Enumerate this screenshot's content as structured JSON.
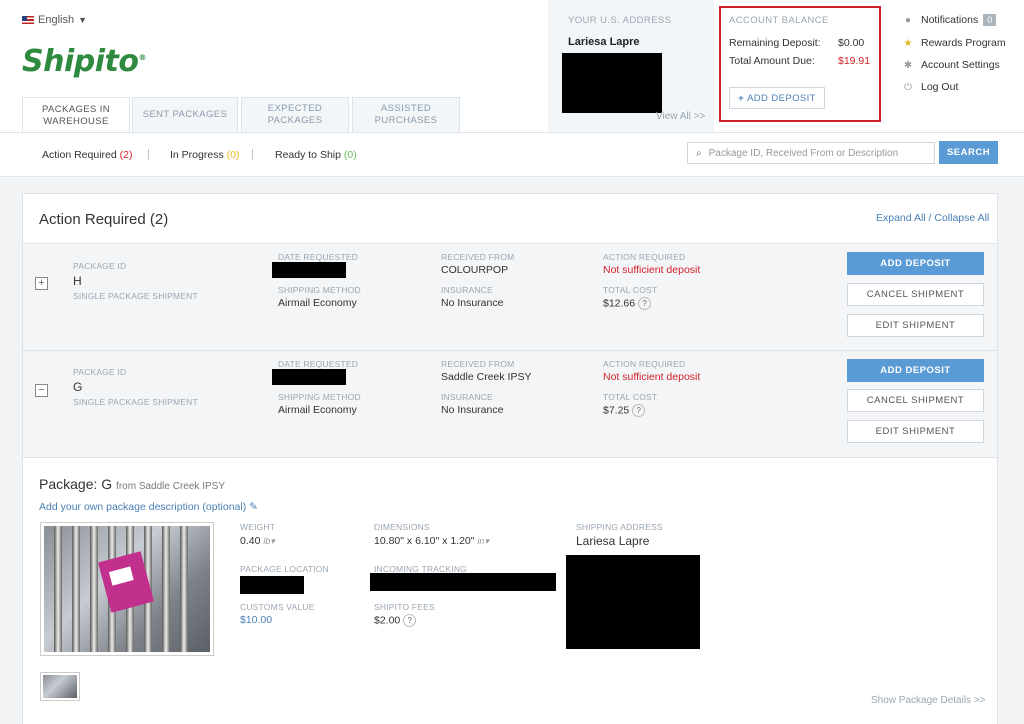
{
  "header": {
    "language": "English",
    "logo_text": "Shipito",
    "logo_mark": "®",
    "tabs": [
      {
        "label_line1": "PACKAGES IN",
        "label_line2": "WAREHOUSE"
      },
      {
        "label_line1": "SENT PACKAGES",
        "label_line2": ""
      },
      {
        "label_line1": "EXPECTED",
        "label_line2": "PACKAGES"
      },
      {
        "label_line1": "ASSISTED",
        "label_line2": "PURCHASES"
      }
    ],
    "address": {
      "title": "YOUR U.S. ADDRESS",
      "name": "Lariesa Lapre",
      "view_all": "View All >>"
    },
    "balance": {
      "title": "ACCOUNT BALANCE",
      "remaining_label": "Remaining Deposit:",
      "remaining_value": "$0.00",
      "due_label": "Total Amount Due:",
      "due_value": "$19.91",
      "button": "ADD DEPOSIT"
    },
    "menu": {
      "notifications": "Notifications",
      "notifications_count": "0",
      "rewards": "Rewards Program",
      "settings": "Account Settings",
      "logout": "Log Out"
    }
  },
  "subnav": {
    "action_required": "Action Required",
    "action_required_count": "(2)",
    "in_progress": "In Progress",
    "in_progress_count": "(0)",
    "ready_to_ship": "Ready to Ship",
    "ready_to_ship_count": "(0)",
    "search_placeholder": "Package ID, Received From or Description",
    "search_button": "SEARCH"
  },
  "card": {
    "title": "Action Required (2)",
    "expand_collapse": "Expand All / Collapse All"
  },
  "labels": {
    "package_id": "PACKAGE ID",
    "single_shipment": "SINGLE PACKAGE SHIPMENT",
    "date_requested": "DATE REQUESTED",
    "shipping_method": "SHIPPING METHOD",
    "received_from": "RECEIVED FROM",
    "insurance": "INSURANCE",
    "action_required": "ACTION REQUIRED",
    "total_cost": "TOTAL COST"
  },
  "rows": [
    {
      "toggle": "+",
      "package_id": "H",
      "shipping_method": "Airmail Economy",
      "received_from": "COLOURPOP",
      "insurance": "No Insurance",
      "action": "Not sufficient deposit",
      "total_cost": "$12.66",
      "buttons": {
        "add": "ADD DEPOSIT",
        "cancel": "CANCEL SHIPMENT",
        "edit": "EDIT SHIPMENT"
      }
    },
    {
      "toggle": "−",
      "package_id": "G",
      "shipping_method": "Airmail Economy",
      "received_from": "Saddle Creek IPSY",
      "insurance": "No Insurance",
      "action": "Not sufficient deposit",
      "total_cost": "$7.25",
      "buttons": {
        "add": "ADD DEPOSIT",
        "cancel": "CANCEL SHIPMENT",
        "edit": "EDIT SHIPMENT"
      }
    }
  ],
  "detail": {
    "title_prefix": "Package:",
    "package_id": "G",
    "from": "from Saddle Creek IPSY",
    "description_link": "Add your own package description (optional)",
    "weight_label": "WEIGHT",
    "weight_value": "0.40",
    "weight_unit": "lb",
    "dimensions_label": "DIMENSIONS",
    "dimensions_value": "10.80\" x 6.10\" x 1.20\"",
    "dimensions_unit": "in",
    "shipping_address_label": "SHIPPING ADDRESS",
    "shipping_address_name": "Lariesa Lapre",
    "location_label": "PACKAGE LOCATION",
    "tracking_label": "INCOMING TRACKING",
    "customs_label": "CUSTOMS VALUE",
    "customs_value": "$10.00",
    "fees_label": "SHIPITO FEES",
    "fees_value": "$2.00",
    "show_details": "Show Package Details >>"
  },
  "colors": {
    "accent": "#5b9bd5",
    "brand": "#2e8a3e",
    "alert": "#d1202a",
    "highlight_box": "#d1202a"
  }
}
